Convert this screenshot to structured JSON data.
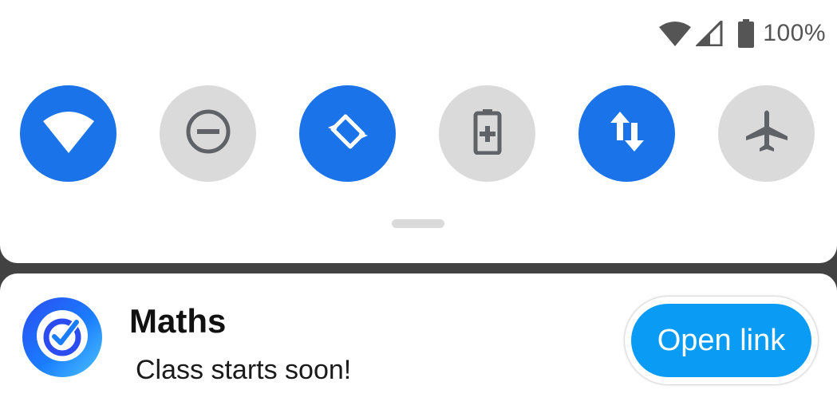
{
  "status_bar": {
    "wifi_icon": "wifi-icon",
    "cellular_icon": "cellular-signal-icon",
    "battery_icon": "battery-full-icon",
    "battery_percent": "100%"
  },
  "quick_settings": {
    "tiles": [
      {
        "name": "wifi",
        "icon": "wifi-icon",
        "state": "on"
      },
      {
        "name": "do-not-disturb",
        "icon": "minus-circle-icon",
        "state": "off"
      },
      {
        "name": "auto-rotate",
        "icon": "rotate-icon",
        "state": "on"
      },
      {
        "name": "battery-saver",
        "icon": "battery-plus-icon",
        "state": "off"
      },
      {
        "name": "mobile-data",
        "icon": "data-arrows-icon",
        "state": "on"
      },
      {
        "name": "airplane-mode",
        "icon": "airplane-icon",
        "state": "off"
      }
    ],
    "colors": {
      "active": "#1a73e8",
      "inactive": "#dadada",
      "inactive_glyph": "#5f6368"
    }
  },
  "notification": {
    "app_icon": "checkmark-circle-icon",
    "title": "Maths",
    "text": "Class starts soon!",
    "action_label": "Open link",
    "action_color": "#0a9bf5"
  }
}
